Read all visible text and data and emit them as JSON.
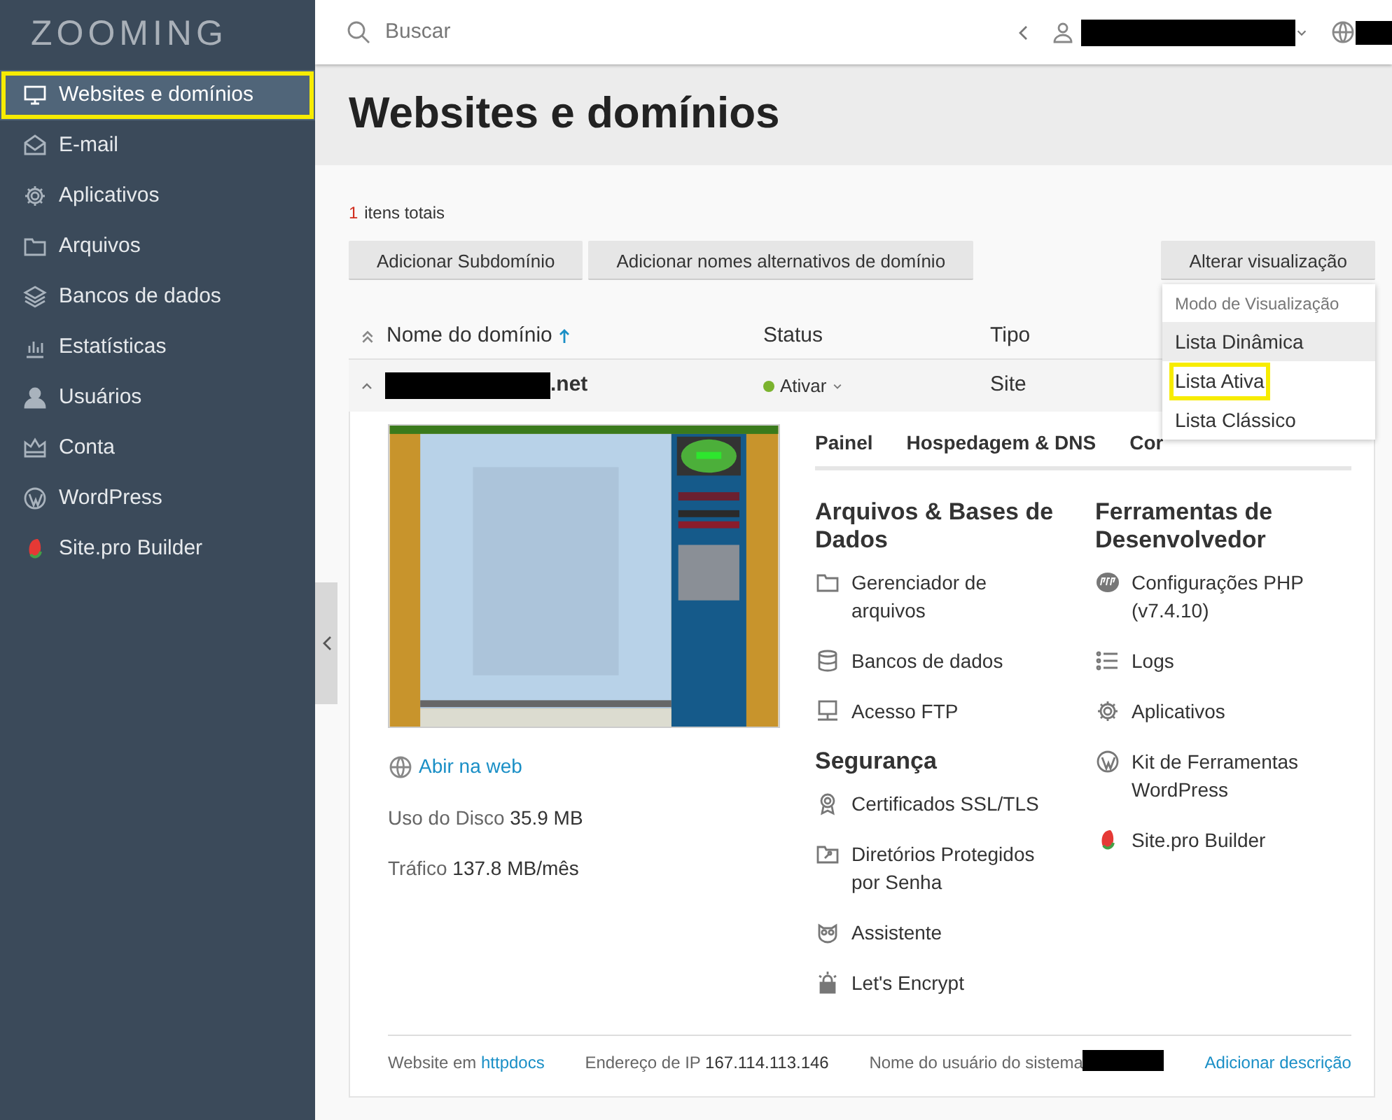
{
  "logo": {
    "text": "ZOOMING"
  },
  "sidebar": {
    "items": [
      {
        "label": "Websites e domínios",
        "kind": "monitor",
        "selected": true,
        "highlighted": true
      },
      {
        "label": "E-mail",
        "kind": "mail",
        "selected": false,
        "highlighted": false
      },
      {
        "label": "Aplicativos",
        "kind": "gear",
        "selected": false,
        "highlighted": false
      },
      {
        "label": "Arquivos",
        "kind": "folder",
        "selected": false,
        "highlighted": false
      },
      {
        "label": "Bancos de dados",
        "kind": "layers",
        "selected": false,
        "highlighted": false
      },
      {
        "label": "Estatísticas",
        "kind": "bars",
        "selected": false,
        "highlighted": false
      },
      {
        "label": "Usuários",
        "kind": "person",
        "selected": false,
        "highlighted": false
      },
      {
        "label": "Conta",
        "kind": "crown",
        "selected": false,
        "highlighted": false
      },
      {
        "label": "WordPress",
        "kind": "wordpress",
        "selected": false,
        "highlighted": false
      },
      {
        "label": "Site.pro Builder",
        "kind": "sitepro",
        "selected": false,
        "highlighted": false
      }
    ]
  },
  "topbar": {
    "search": {
      "placeholder": "Buscar"
    }
  },
  "page": {
    "title": "Websites e domínios"
  },
  "summary": {
    "count": "1",
    "label": "itens totais"
  },
  "toolbar": {
    "buttons": [
      "Adicionar Subdomínio",
      "Adicionar nomes alternativos de domínio"
    ],
    "view_button": "Alterar visualização"
  },
  "view_menu": {
    "header": "Modo de Visualização",
    "items": [
      {
        "label": "Lista Dinâmica",
        "selected": true,
        "highlighted": false
      },
      {
        "label": "Lista Ativa",
        "selected": false,
        "highlighted": true
      },
      {
        "label": "Lista Clássico",
        "selected": false,
        "highlighted": false
      }
    ]
  },
  "table": {
    "columns": [
      {
        "label": "Nome do domínio",
        "sorted": true
      },
      {
        "label": "Status",
        "sorted": false
      },
      {
        "label": "Tipo",
        "sorted": false
      }
    ],
    "rows": [
      {
        "domain": ".net",
        "expanded": true,
        "status": "Ativar",
        "type": "Site"
      }
    ]
  },
  "details": {
    "open_link": "Abir na web",
    "stats": [
      {
        "label": "Uso do Disco",
        "value": "35.9 MB"
      },
      {
        "label": "Tráfico",
        "value": "137.8 MB/mês"
      }
    ],
    "tabs": [
      {
        "label": "Painel",
        "selected": true
      },
      {
        "label": "Hospedagem & DNS",
        "selected": false
      },
      {
        "label": "Cor",
        "selected": false
      }
    ],
    "columns": [
      {
        "sections": [
          {
            "title": "Arquivos & Bases de Dados",
            "items": [
              {
                "label": "Gerenciador de arquivos",
                "kind": "folder"
              },
              {
                "label": "Bancos de dados",
                "kind": "database"
              },
              {
                "label": "Acesso FTP",
                "kind": "ftp"
              }
            ]
          },
          {
            "title": "Segurança",
            "items": [
              {
                "label": "Certificados SSL/TLS",
                "kind": "ribbon"
              },
              {
                "label": "Diretórios Protegidos por Senha",
                "kind": "lockfolder"
              },
              {
                "label": "Assistente",
                "kind": "owl"
              },
              {
                "label": "Let's Encrypt",
                "kind": "padlock"
              }
            ]
          }
        ]
      },
      {
        "sections": [
          {
            "title": "Ferramentas de Desenvolvedor",
            "items": [
              {
                "label": "Configurações PHP (v7.4.10)",
                "kind": "php"
              },
              {
                "label": "Logs",
                "kind": "list"
              },
              {
                "label": "Aplicativos",
                "kind": "gear"
              },
              {
                "label": "Kit de Ferramentas WordPress",
                "kind": "wordpress"
              },
              {
                "label": "Site.pro Builder",
                "kind": "sitepro"
              }
            ]
          }
        ]
      }
    ],
    "footer": {
      "website_label": "Website em",
      "website_link": "httpdocs",
      "ip_label": "Endereço de IP",
      "ip": "167.114.113.146",
      "user_label": "Nome do usuário do sistema",
      "add_link": "Adicionar descrição"
    }
  }
}
